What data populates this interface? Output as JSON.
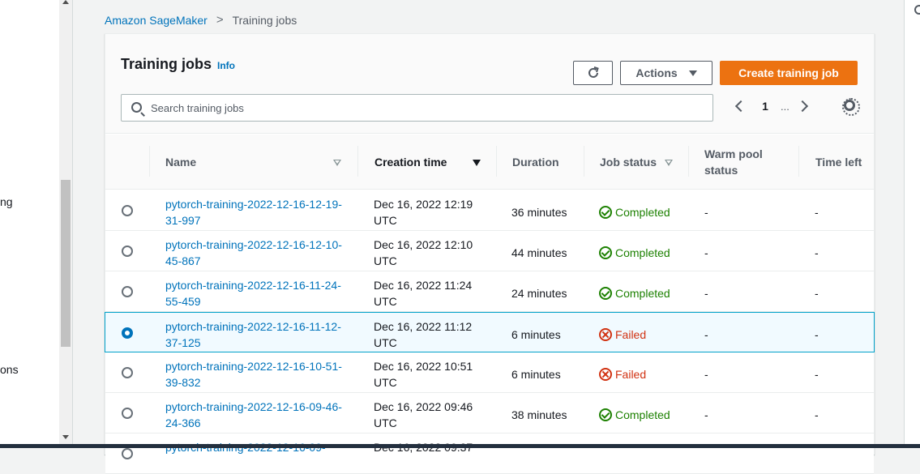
{
  "sidebar": {
    "fragments": [
      "ng",
      "ons"
    ]
  },
  "breadcrumb": {
    "root": "Amazon SageMaker",
    "current": "Training jobs"
  },
  "header": {
    "title": "Training jobs",
    "info": "Info",
    "actions_label": "Actions",
    "create_label": "Create training job"
  },
  "search": {
    "placeholder": "Search training jobs"
  },
  "pagination": {
    "current_page": "1",
    "ellipsis": "..."
  },
  "table": {
    "columns": {
      "name": "Name",
      "creation_time": "Creation time",
      "duration": "Duration",
      "job_status": "Job status",
      "warm_pool_status": "Warm pool status",
      "time_left": "Time left"
    },
    "sorted_by": "Creation time",
    "sort_direction": "descending",
    "rows": [
      {
        "name": "pytorch-training-2022-12-16-12-19-31-997",
        "creation_time": "Dec 16, 2022 12:19 UTC",
        "duration": "36 minutes",
        "status": "Completed",
        "warm_pool": "-",
        "time_left": "-",
        "selected": false
      },
      {
        "name": "pytorch-training-2022-12-16-12-10-45-867",
        "creation_time": "Dec 16, 2022 12:10 UTC",
        "duration": "44 minutes",
        "status": "Completed",
        "warm_pool": "-",
        "time_left": "-",
        "selected": false
      },
      {
        "name": "pytorch-training-2022-12-16-11-24-55-459",
        "creation_time": "Dec 16, 2022 11:24 UTC",
        "duration": "24 minutes",
        "status": "Completed",
        "warm_pool": "-",
        "time_left": "-",
        "selected": false
      },
      {
        "name": "pytorch-training-2022-12-16-11-12-37-125",
        "creation_time": "Dec 16, 2022 11:12 UTC",
        "duration": "6 minutes",
        "status": "Failed",
        "warm_pool": "-",
        "time_left": "-",
        "selected": true
      },
      {
        "name": "pytorch-training-2022-12-16-10-51-39-832",
        "creation_time": "Dec 16, 2022 10:51 UTC",
        "duration": "6 minutes",
        "status": "Failed",
        "warm_pool": "-",
        "time_left": "-",
        "selected": false
      },
      {
        "name": "pytorch-training-2022-12-16-09-46-24-366",
        "creation_time": "Dec 16, 2022 09:46 UTC",
        "duration": "38 minutes",
        "status": "Completed",
        "warm_pool": "-",
        "time_left": "-",
        "selected": false
      },
      {
        "name": "pytorch-training-2022-12-16-09-",
        "creation_time": "Dec 16, 2022 09:37",
        "duration": "",
        "status": "",
        "warm_pool": "",
        "time_left": "",
        "selected": false
      }
    ]
  },
  "colors": {
    "link": "#0073bb",
    "primary_button": "#ec7211",
    "completed": "#1d8102",
    "failed": "#d13212",
    "selected_row_border": "#00a1c9"
  },
  "icons": {
    "refresh": "refresh-icon",
    "caret": "caret-down-icon",
    "search": "search-icon",
    "prev": "chevron-left-icon",
    "next": "chevron-right-icon",
    "settings": "gear-icon",
    "completed": "check-circle-icon",
    "failed": "x-circle-icon"
  }
}
